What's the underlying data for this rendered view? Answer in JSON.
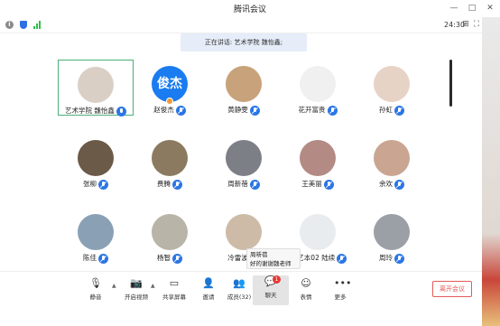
{
  "window": {
    "title": "腾讯会议",
    "minimize_glyph": "—",
    "maximize_glyph": "□",
    "close_glyph": "✕"
  },
  "statusbar": {
    "time": "24:30",
    "info_glyph": "i",
    "pin_glyph": "⊞",
    "fullscreen_glyph": "⛶"
  },
  "speaking": {
    "label": "正在讲话: 艺术学院 魏怡鑫;"
  },
  "participants": [
    {
      "name": "艺术学院 魏怡鑫",
      "avatar_color": "#d9cfc4",
      "mic": "on",
      "active": true
    },
    {
      "name": "赵俊杰",
      "avatar_text": "俊杰",
      "avatar_color": "#1a7cf0",
      "mic": "muted",
      "host": true
    },
    {
      "name": "黄静雯",
      "avatar_color": "#c8a27a",
      "mic": "muted"
    },
    {
      "name": "花开富贵",
      "avatar_color": "#f0f0f0",
      "mic": "muted"
    },
    {
      "name": "孙虹",
      "avatar_color": "#e7d3c6",
      "mic": "muted"
    },
    {
      "name": "张柳",
      "avatar_color": "#6b5a48",
      "mic": "muted"
    },
    {
      "name": "费腾",
      "avatar_color": "#8b7a60",
      "mic": "muted"
    },
    {
      "name": "周新蓓",
      "avatar_color": "#7d7f86",
      "mic": "muted"
    },
    {
      "name": "王美丽",
      "avatar_color": "#b48a84",
      "mic": "muted"
    },
    {
      "name": "余欢",
      "avatar_color": "#c9a592",
      "mic": "muted"
    },
    {
      "name": "陈佳",
      "avatar_color": "#8aa0b4",
      "mic": "muted"
    },
    {
      "name": "杨智",
      "avatar_color": "#b9b4a8",
      "mic": "muted"
    },
    {
      "name": "冷雷波",
      "avatar_color": "#cdbba7",
      "mic": "muted"
    },
    {
      "name": "17艺本02 陆续",
      "avatar_color": "#e9ecef",
      "mic": "muted"
    },
    {
      "name": "周玲",
      "avatar_color": "#9aa0a6",
      "mic": "muted"
    }
  ],
  "toast": {
    "sender": "周新蓓",
    "message": "好的谢谢魏老师"
  },
  "toolbar": {
    "mute": {
      "label": "静音",
      "icon": "microphone-icon"
    },
    "video": {
      "label": "开启视频",
      "icon": "camera-off-icon"
    },
    "share": {
      "label": "共享屏幕",
      "icon": "screen-share-icon"
    },
    "invite": {
      "label": "邀请",
      "icon": "add-user-icon"
    },
    "members": {
      "label": "成员(32)",
      "icon": "members-icon"
    },
    "chat": {
      "label": "聊天",
      "icon": "chat-icon",
      "badge": "1"
    },
    "reactions": {
      "label": "表情",
      "icon": "emoji-icon"
    },
    "more": {
      "label": "更多",
      "icon": "more-icon"
    },
    "leave": {
      "label": "离开会议"
    }
  },
  "colors": {
    "accent": "#2b76e5",
    "leave": "#e35b5b",
    "active_border": "#4caf7a",
    "badge": "#e53935"
  }
}
